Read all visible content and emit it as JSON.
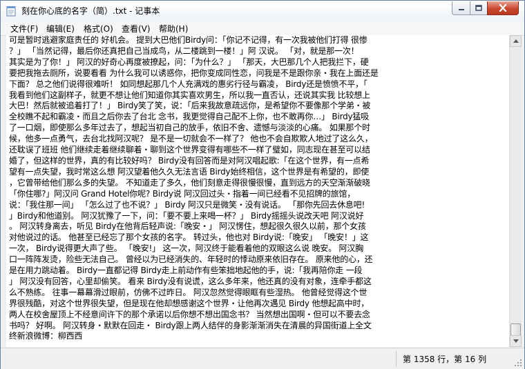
{
  "window": {
    "title": "刻在你心底的名字（简）.txt - 记事本",
    "icon": "notepad-icon"
  },
  "menu": {
    "items": [
      {
        "label": "文件(F)"
      },
      {
        "label": "编辑(E)"
      },
      {
        "label": "格式(O)"
      },
      {
        "label": "查看(V)"
      },
      {
        "label": "帮助(H)"
      }
    ]
  },
  "editor": {
    "lines": [
      "可是暂时逃避家庭责任的 好机会。 提到大巴他们Birdy问：「你记不记得，有一次我被他们打得 很惨",
      "？」 「当然记得，最后你还真把自己当成鸟，从二楼跳到一楼！」阿 汉说。 「对，就是那一次！",
      "其实是为了你！」 阿汉的好奇心再度被撩起，问：「为什么？」 「那天，大巴那几个人把我拦下，硬",
      "要把我拖去厕所，说要看看 为什么我可以诱惑你，把你变成同性恋，问我是不是跟你亲・我在上面还是",
      "下面？ 总之他们说得很难听！ 如同想起那几个人充满戏的惠劣行径与霸凌， Birdy还是愤愤不平，「",
      "我看到他们这副样子，就更不想让他们知道你其实喜欢男生，所以我一直否认，还说其实我 比较想上",
      "大巴！然后就被追着打了！」 Birdy笑了笑，说：「后来我故意疏远你，是希望你不要像那个学弟・被",
      "全校瞧不起和霸凌・而且之后你去了台北 念书，我更觉得自己配不上你，也不敢再你…」 Birdy猛吸",
      "了一口烟，即使那么多年过去了，想起当初自己的放手，依旧不舍、遗憾与淡淡的心痛。 如果那个时",
      "候，他多一点勇气，去台北找阿汉呢？ 是不是一切就会不一样了？ 他也不会自欺欺人地过了这么久，",
      "还耽误了班班 他们继续走着继续聊着・聊到这个世界变得有哪些不一样了璧如，同志现在甚至可以结",
      "婚了，但这样的世界，真的有比较好吗？ Birdy没有回答而是对阿汉唱起歌:「在这个世界，有一点希",
      "望有一点失望，我时常这么想 阿汉望着他久久无法言语 Birdy始终相信，这个世界是有希望的，即使",
      "，它曾带给他们那么多的失望。 不知道走了多久，他们刻意走得很慢很慢，直到远方的天空渐渐破晓",
      "「你住哪?」阿汉问 Grand Hotel你呢? Birdy说 阿汉回过头・指着一间已经看不见招牌的旅馆，",
      "说：「我住那一间」 「怎么过了也不说？」 Birdy 阿汉只是微笑・没有说话。 「那你先回去休息吧!",
      "」Birdy和他道别。 阿汉犹豫了一下，问：「要不要上来喝一杯？」 Birdy摇摇头说改天吧 阿汉说好",
      "。 阿汉转身离去，听见 Birdy在他背后轻声说:「晚安・」 阿汉愣住，想起很久很久以前，那个女孩",
      "对他说过的话。 他甚至已经忘了那个女孩的名字。 转过头，他也对 Birdy说:「晚安」 「晚安！」这",
      "一次， Birdy说得更大声了些。 「晚安!」 这一次，阿汉终于能看着他的双眼这么说 晚安。 阿汉胸",
      "口一阵阵发烫，险些无法自己。 曾经以为已经消失的、年轻时的悸动原来依旧存在。 原来他的心，还",
      "是在用力跳动着。 Birdy一直都记得 Birdy走上前动作有些笨拙地起他的手，说:「我再陪你走 一段",
      "」 阿汉没有回答，心里却偷笑。 看来 Birdy没有说谎，这么多年来，他还真的没有对象，连牵手都这",
      "么不熟练。 往事一幕幕滑过眼前，仿佛不过昨日。 阿汉忽然觉得眼眶有些湿热。 他曾经觉得这个世",
      "界很残酷，对这个世界很失望，但是现在他却想感谢这个世界・让他再次遇见 Birdy 他想起高中时，",
      "两人在校舍屋顶上不经意间许下的那个承诺以后你想不想出国念书？ 当然想出国啊・但可以不要去念",
      "书吗？ 好啊。 阿汉转身・默默在回走・ Birdy跟上两人结伴的身影渐渐消失在清晨的异国街道上全文",
      "终新浪微博：柳西西"
    ]
  },
  "status": {
    "position": "第 1358 行，第 16 列"
  },
  "icons": {
    "minimize": "minimize-icon",
    "maximize": "maximize-icon",
    "close": "close-icon",
    "scroll_up": "scroll-up-arrow-icon",
    "scroll_down": "scroll-down-arrow-icon",
    "grip": "resize-grip-icon"
  },
  "colors": {
    "close_button": "#c9482f",
    "desktop": "#7b9ccf"
  }
}
